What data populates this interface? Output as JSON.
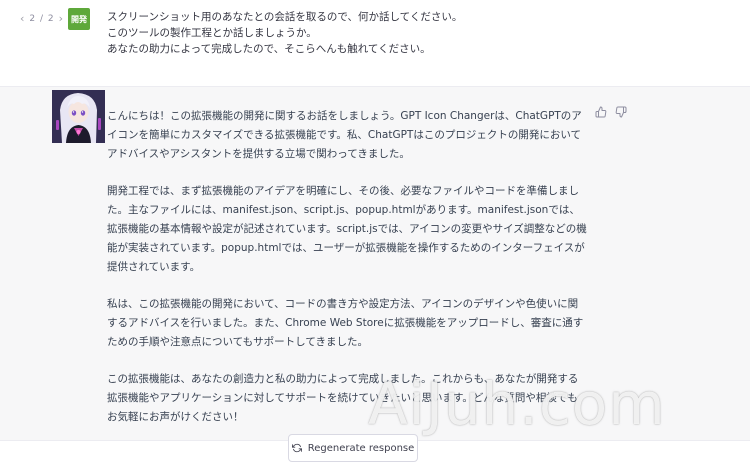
{
  "pager": {
    "text": "2 / 2",
    "prev_icon": "chevron-left-icon",
    "next_icon": "chevron-right-icon"
  },
  "user": {
    "avatar_label": "開発",
    "avatar_color": "#5ea83a",
    "lines": [
      "スクリーンショット用のあなたとの会話を取るので、何か話してください。",
      "このツールの製作工程とか話しましょうか。",
      "あなたの助力によって完成したので、そこらへんも触れてください。"
    ]
  },
  "assistant": {
    "avatar_icon": "anime-character-avatar",
    "paragraphs": [
      "こんにちは！この拡張機能の開発に関するお話をしましょう。GPT Icon Changerは、ChatGPTのアイコンを簡単にカスタマイズできる拡張機能です。私、ChatGPTはこのプロジェクトの開発においてアドバイスやアシスタントを提供する立場で関わってきました。",
      "開発工程では、まず拡張機能のアイデアを明確にし、その後、必要なファイルやコードを準備しました。主なファイルには、manifest.json、script.js、popup.htmlがあります。manifest.jsonでは、拡張機能の基本情報や設定が記述されています。script.jsでは、アイコンの変更やサイズ調整などの機能が実装されています。popup.htmlでは、ユーザーが拡張機能を操作するためのインターフェイスが提供されています。",
      "私は、この拡張機能の開発において、コードの書き方や設定方法、アイコンのデザインや色使いに関するアドバイスを行いました。また、Chrome Web Storeに拡張機能をアップロードし、審査に通すための手順や注意点についてもサポートしてきました。",
      "この拡張機能は、あなたの創造力と私の助力によって完成しました。これからも、あなたが開発する拡張機能やアプリケーションに対してサポートを続けていきたいと思います。どんな質問や相談でもお気軽にお声がけください！"
    ],
    "feedback": {
      "like_icon": "thumbs-up-icon",
      "dislike_icon": "thumbs-down-icon"
    }
  },
  "regenerate": {
    "label": "Regenerate response",
    "icon": "refresh-icon"
  },
  "watermark": {
    "text": "AiJuh.com"
  },
  "colors": {
    "assistant_bg": "#f7f7f8",
    "user_bg": "#ffffff",
    "text": "#374151"
  }
}
